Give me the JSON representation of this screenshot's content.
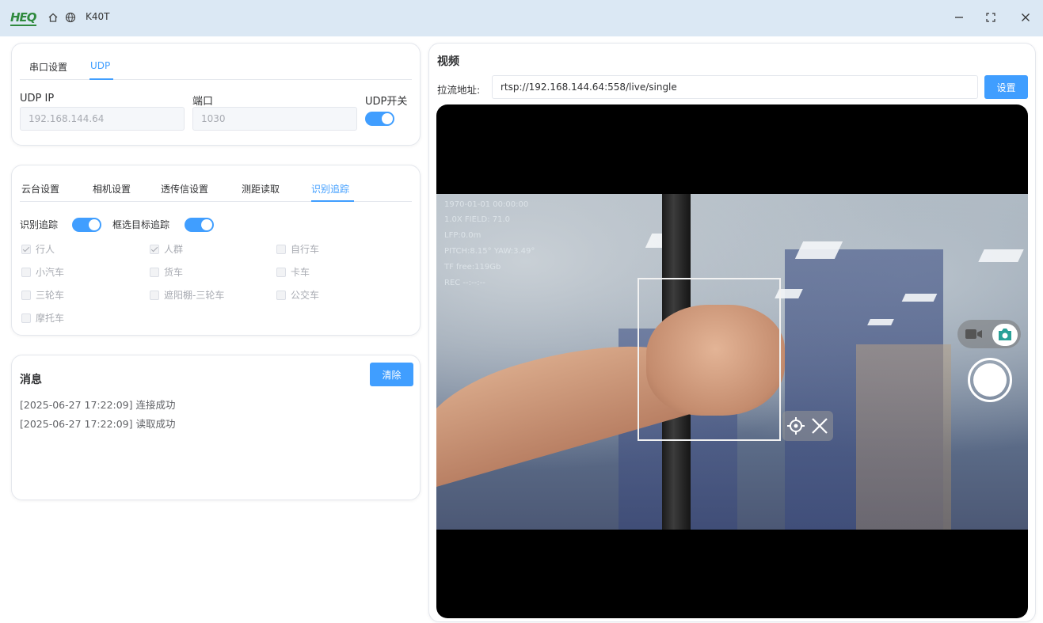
{
  "titlebar": {
    "logo": "HEQ",
    "title": "K40T",
    "icons": [
      "home-icon",
      "globe-icon"
    ],
    "window_controls": [
      "minimize-icon",
      "maximize-icon",
      "close-icon"
    ]
  },
  "connection": {
    "tabs": [
      "串口设置",
      "UDP"
    ],
    "active_tab": "UDP",
    "ip_label": "UDP IP",
    "ip_value": "192.168.144.64",
    "port_label": "端口",
    "port_value": "1030",
    "switch_label": "UDP开关",
    "switch_on": true
  },
  "settings": {
    "tabs": [
      "云台设置",
      "相机设置",
      "透传信设置",
      "测距读取",
      "识别追踪"
    ],
    "active_tab": "识别追踪",
    "recognition_label": "识别追踪",
    "recognition_on": true,
    "box_track_label": "框选目标追踪",
    "box_track_on": true,
    "targets": [
      {
        "label": "行人",
        "checked": true
      },
      {
        "label": "人群",
        "checked": true
      },
      {
        "label": "自行车",
        "checked": false
      },
      {
        "label": "小汽车",
        "checked": false
      },
      {
        "label": "货车",
        "checked": false
      },
      {
        "label": "卡车",
        "checked": false
      },
      {
        "label": "三轮车",
        "checked": false
      },
      {
        "label": "遮阳棚-三轮车",
        "checked": false
      },
      {
        "label": "公交车",
        "checked": false
      },
      {
        "label": "摩托车",
        "checked": false
      }
    ]
  },
  "messages": {
    "title": "消息",
    "clear_label": "清除",
    "lines": [
      "[2025-06-27 17:22:09] 连接成功",
      "[2025-06-27 17:22:09] 读取成功"
    ]
  },
  "video": {
    "title": "视频",
    "url_label": "拉流地址:",
    "url_value": "rtsp://192.168.144.64:558/live/single",
    "set_label": "设置",
    "osd": [
      "1970-01-01 00:00:00",
      "1.0X  FIELD: 71.0",
      "LFP:0.0m",
      "PITCH:8.15° YAW:3.49°",
      "TF free:119Gb",
      "REC --:--:--"
    ]
  }
}
